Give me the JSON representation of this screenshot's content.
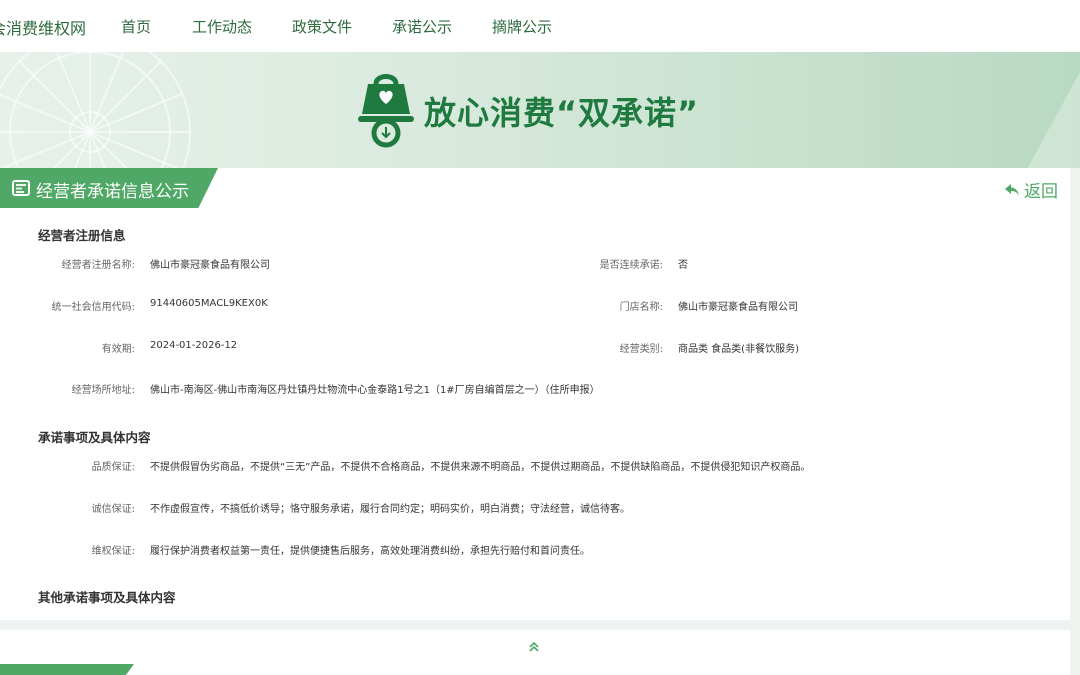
{
  "nav": {
    "site_name": "会消费维权网",
    "items": [
      "首页",
      "工作动态",
      "政策文件",
      "承诺公示",
      "摘牌公示"
    ]
  },
  "banner": {
    "title": "放心消费“双承诺”"
  },
  "section": {
    "title": "经营者承诺信息公示",
    "back_label": "返回"
  },
  "registration": {
    "heading": "经营者注册信息",
    "name_label": "经营者注册名称:",
    "name_value": "佛山市豪冠豪食品有限公司",
    "continuous_label": "是否连续承诺:",
    "continuous_value": "否",
    "credit_label": "统一社会信用代码:",
    "credit_value": "91440605MACL9KEX0K",
    "store_label": "门店名称:",
    "store_value": "佛山市豪冠豪食品有限公司",
    "validity_label": "有效期:",
    "validity_value": "2024-01-2026-12",
    "category_label": "经营类别:",
    "category_value": "商品类 食品类(非餐饮服务)",
    "address_label": "经营场所地址:",
    "address_value": "佛山市-南海区-佛山市南海区丹灶镇丹灶物流中心金泰路1号之1（1#厂房自编首层之一）（住所申报）"
  },
  "commitments": {
    "heading": "承诺事项及具体内容",
    "quality_label": "品质保证:",
    "quality_value": "不提供假冒伪劣商品，不提供“三无”产品，不提供不合格商品，不提供来源不明商品，不提供过期商品，不提供缺陷商品，不提供侵犯知识产权商品。",
    "integrity_label": "诚信保证:",
    "integrity_value": "不作虚假宣传，不搞低价诱导；恪守服务承诺，履行合同约定；明码实价，明白消费；守法经营，诚信待客。",
    "rights_label": "维权保证:",
    "rights_value": "履行保护消费者权益第一责任，提供便捷售后服务，高效处理消费纠纷，承担先行赔付和首问责任。"
  },
  "other": {
    "heading": "其他承诺事项及具体内容"
  },
  "colors": {
    "accent": "#4fa865",
    "brand_dark": "#1f7a3f",
    "nav_text": "#2f6b3e"
  }
}
